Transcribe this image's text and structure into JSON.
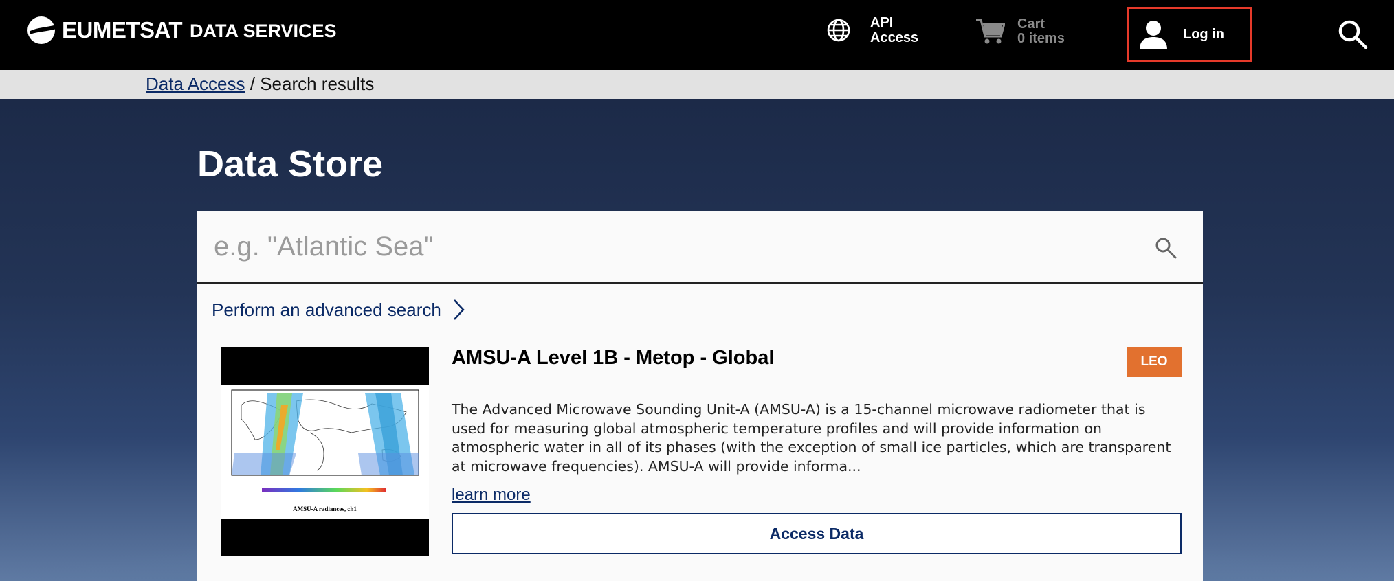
{
  "header": {
    "logo_text": "EUMETSAT",
    "brand_sub": "DATA SERVICES",
    "api": {
      "line1": "API",
      "line2": "Access"
    },
    "cart": {
      "line1": "Cart",
      "line2": "0 items"
    },
    "login_label": "Log in"
  },
  "breadcrumb": {
    "link": "Data Access",
    "separator": " / ",
    "current": "Search results"
  },
  "page_title": "Data Store",
  "search": {
    "placeholder": "e.g. \"Atlantic Sea\""
  },
  "advanced_search_label": "Perform an advanced search",
  "result": {
    "title": "AMSU-A Level 1B - Metop - Global",
    "badge": "LEO",
    "description": "The Advanced Microwave Sounding Unit-A (AMSU-A) is a 15-channel microwave radiometer that is used for measuring global atmospheric temperature profiles and will provide information on atmospheric water in all of its phases (with the exception of small ice particles, which are transparent at microwave frequencies). AMSU-A will provide informa...",
    "learn_more": "learn more",
    "access_label": "Access Data",
    "thumb_caption": "AMSU-A radiances, ch1"
  },
  "colors": {
    "accent_navy": "#0b2a66",
    "badge_orange": "#e2712f",
    "highlight_red": "#e63a2a"
  }
}
